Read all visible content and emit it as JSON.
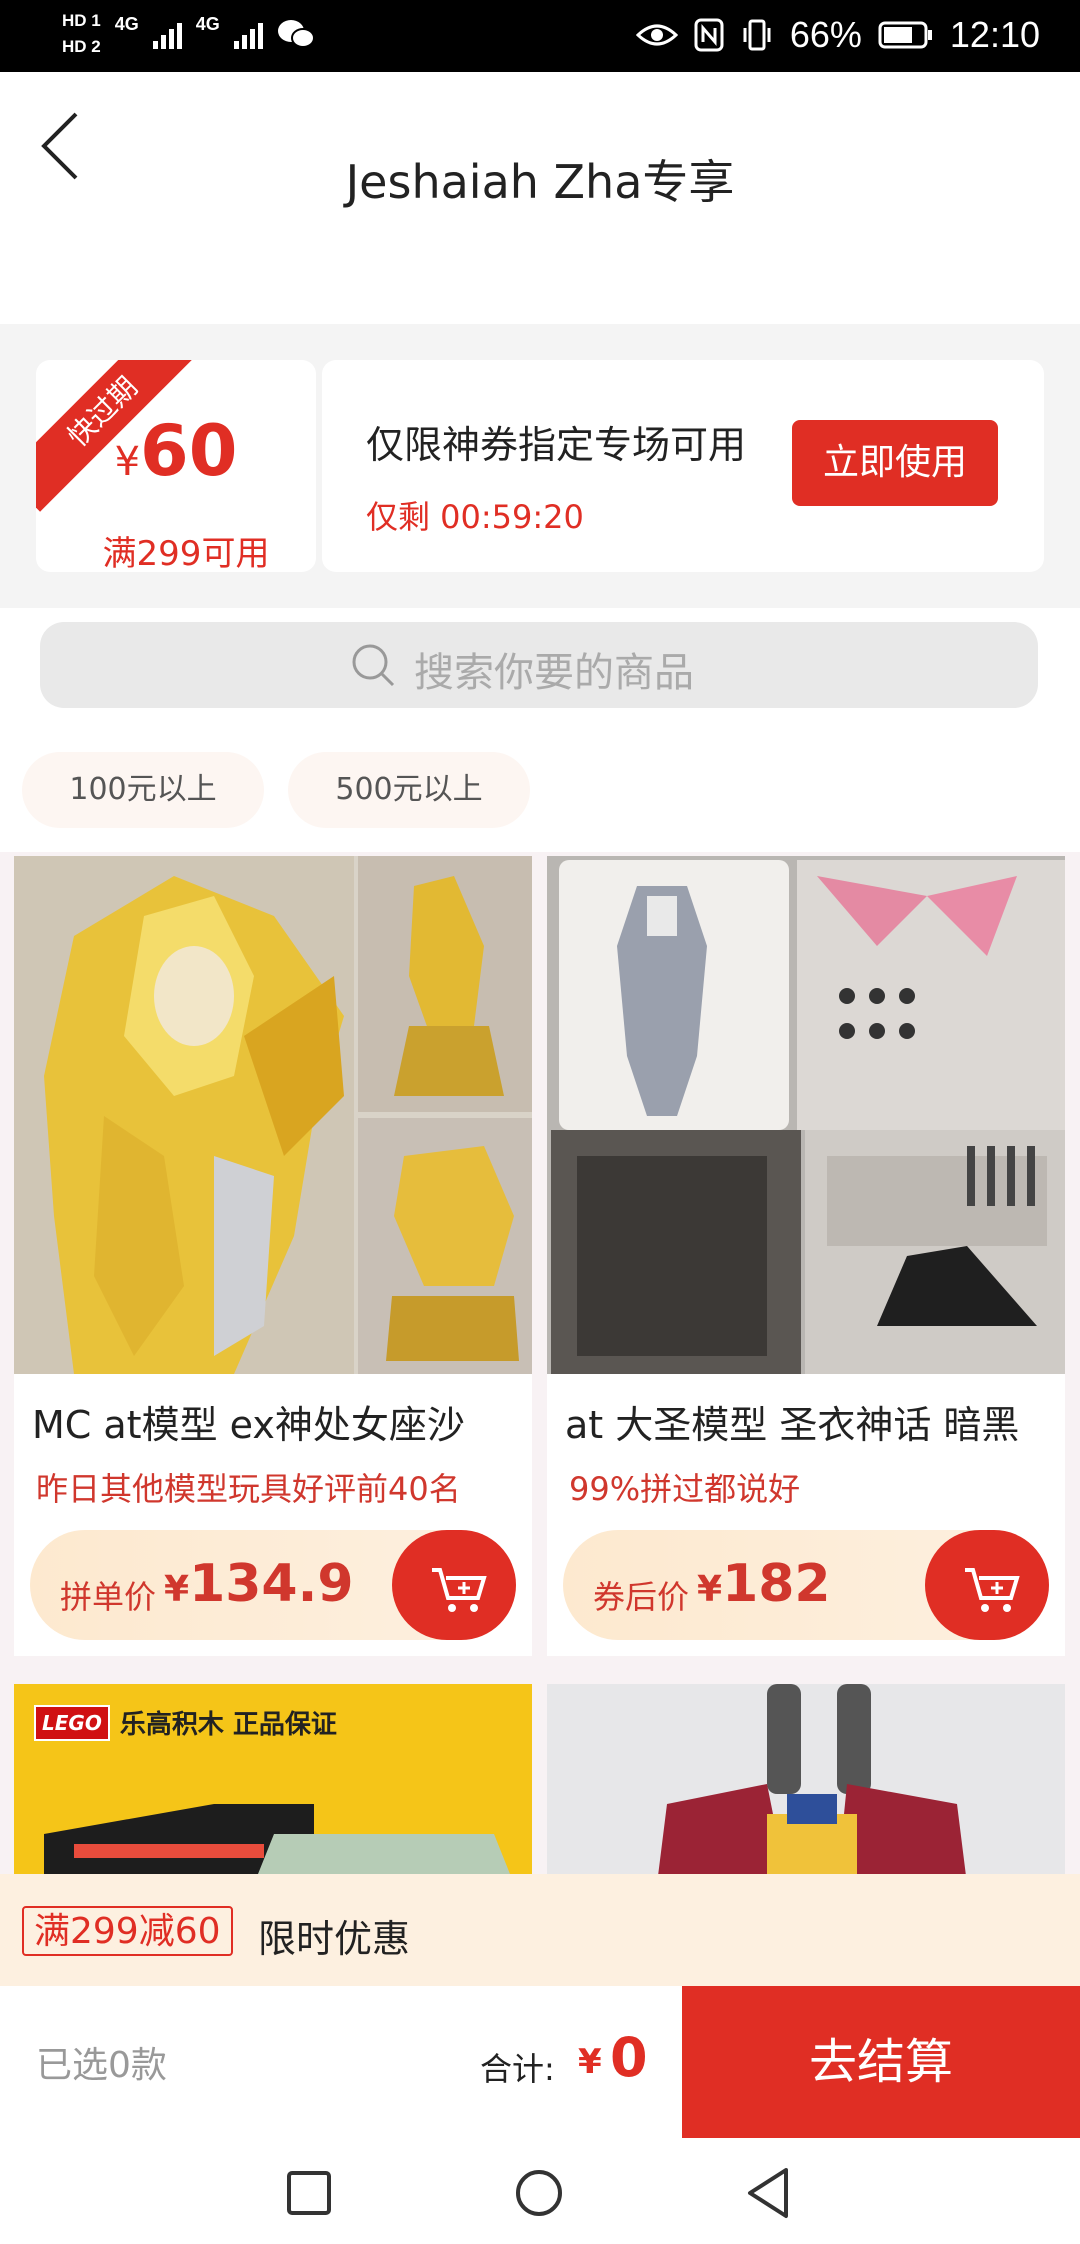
{
  "status_bar": {
    "hd1": "HD 1",
    "hd2": "HD 2",
    "net1": "4G",
    "net2": "4G",
    "battery": "66%",
    "time": "12:10"
  },
  "header": {
    "title": "Jeshaiah Zha专享"
  },
  "coupon": {
    "ribbon": "快过期",
    "currency": "¥",
    "amount": "60",
    "condition": "满299可用",
    "description": "仅限神券指定专场可用",
    "countdown": "仅剩 00:59:20",
    "use_button": "立即使用"
  },
  "search": {
    "placeholder": "搜索你要的商品"
  },
  "filters": [
    "100元以上",
    "500元以上"
  ],
  "products": [
    {
      "name": "MC at模型 ex神处女座沙",
      "tag": "昨日其他模型玩具好评前40名",
      "price_label": "拼单价",
      "price": "134.9"
    },
    {
      "name": "at 大圣模型 圣衣神话 暗黑",
      "tag": "99%拼过都说好",
      "price_label": "券后价",
      "price": "182"
    }
  ],
  "lego_banner": {
    "brand": "LEGO",
    "text": "乐高积木 正品保证"
  },
  "promo": {
    "badge": "满299减60",
    "text": "限时优惠"
  },
  "checkout": {
    "selected": "已选0款",
    "total_label": "合计:",
    "currency": "¥",
    "total": "0",
    "button": "去结算"
  },
  "colors": {
    "accent": "#e02e24",
    "price_bar": "#fde9cf"
  }
}
